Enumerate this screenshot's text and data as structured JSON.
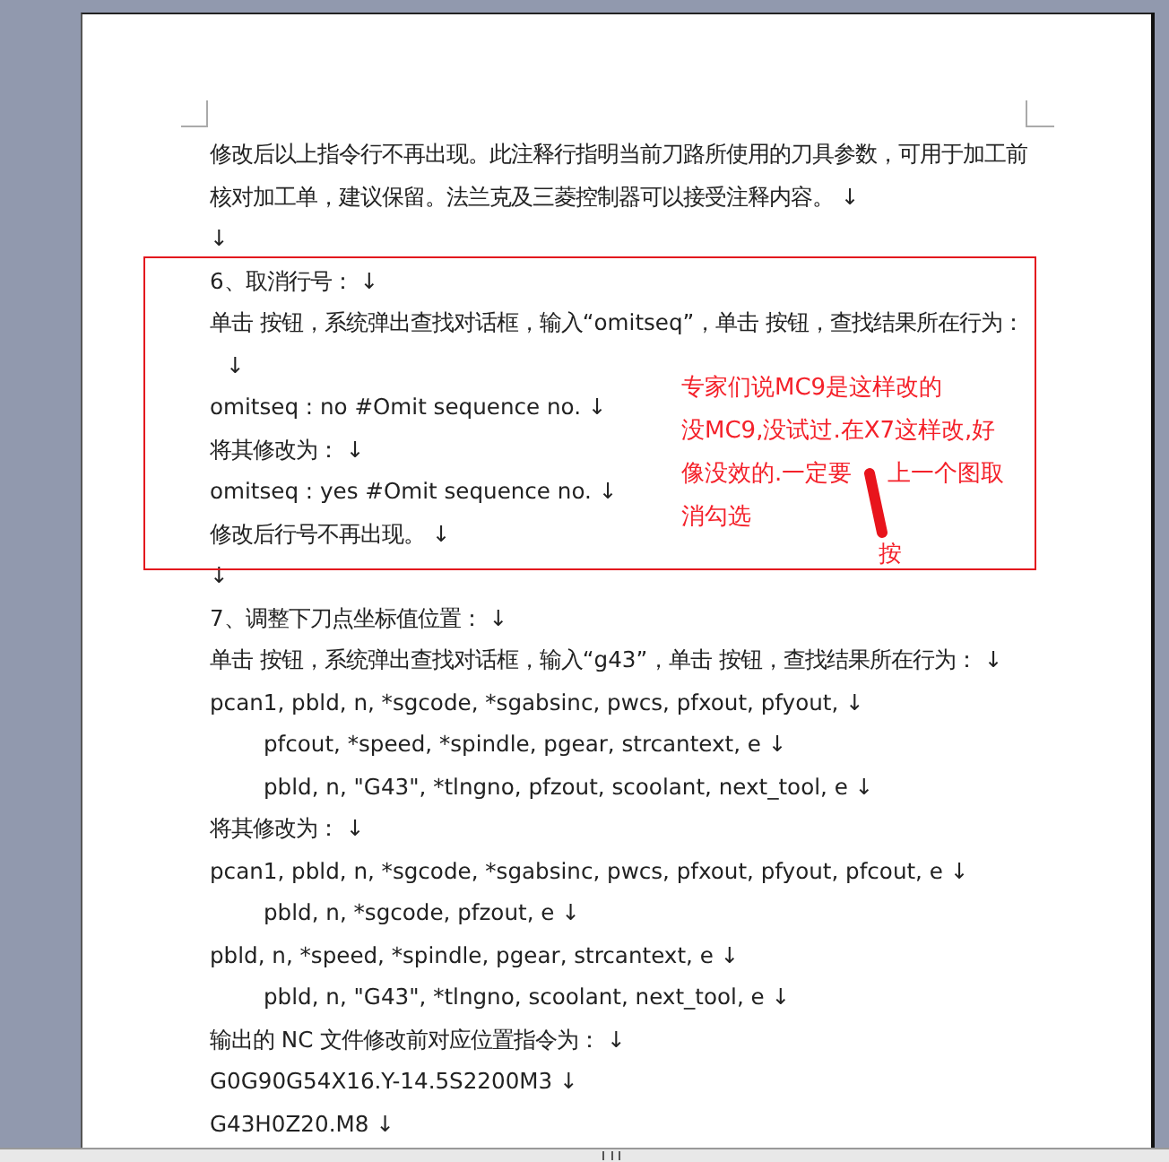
{
  "document": {
    "lines": [
      {
        "kind": "plain",
        "text": "修改后以上指令行不再出现。此注释行指明当前刀路所使用的刀具参数，可用于加工前"
      },
      {
        "kind": "plain",
        "text": "核对加工单，建议保留。法兰克及三菱控制器可以接受注释内容。 ↓"
      },
      {
        "kind": "plain",
        "text": "↓"
      },
      {
        "kind": "plain",
        "text": "6、取消行号：  ↓"
      },
      {
        "kind": "plain",
        "text": "单击  按钮，系统弹出查找对话框，输入“omitseq”，单击  按钮，查找结果所在行为："
      },
      {
        "kind": "continuation",
        "text": "↓"
      },
      {
        "kind": "plain",
        "text": "omitseq : no  #Omit sequence no. ↓"
      },
      {
        "kind": "plain",
        "text": "将其修改为：  ↓"
      },
      {
        "kind": "plain",
        "text": "omitseq : yes  #Omit sequence no. ↓"
      },
      {
        "kind": "plain",
        "text": "修改后行号不再出现。  ↓"
      },
      {
        "kind": "plain",
        "text": "↓"
      },
      {
        "kind": "plain",
        "text": "7、调整下刀点坐标值位置：  ↓"
      },
      {
        "kind": "plain",
        "text": "单击  按钮，系统弹出查找对话框，输入“g43”，单击  按钮，查找结果所在行为：  ↓"
      },
      {
        "kind": "plain",
        "text": "pcan1, pbld, n, *sgcode, *sgabsinc, pwcs, pfxout, pfyout, ↓"
      },
      {
        "kind": "indented",
        "text": "pfcout, *speed, *spindle, pgear, strcantext, e ↓"
      },
      {
        "kind": "indented",
        "text": "pbld, n, \"G43\", *tlngno, pfzout, scoolant, next_tool, e ↓"
      },
      {
        "kind": "plain",
        "text": "将其修改为：  ↓"
      },
      {
        "kind": "plain",
        "text": "pcan1, pbld, n, *sgcode, *sgabsinc, pwcs, pfxout, pfyout, pfcout, e ↓"
      },
      {
        "kind": "indented",
        "text": "pbld, n, *sgcode, pfzout, e ↓"
      },
      {
        "kind": "plain",
        "text": "pbld, n, *speed, *spindle, pgear, strcantext, e ↓"
      },
      {
        "kind": "indented",
        "text": "pbld, n, \"G43\", *tlngno, scoolant, next_tool, e ↓"
      },
      {
        "kind": "plain",
        "text": "输出的 NC 文件修改前对应位置指令为：  ↓"
      },
      {
        "kind": "plain",
        "text": "G0G90G54X16.Y-14.5S2200M3 ↓"
      },
      {
        "kind": "plain",
        "text": "G43H0Z20.M8 ↓"
      }
    ]
  },
  "annotation": {
    "lines": [
      [
        "专家们说MC9是这样改的"
      ],
      [
        "没MC9,没试过.在X7这样改,好"
      ],
      [
        "像没效的.一定要",
        "上一个图取"
      ],
      [
        "消勾选"
      ]
    ],
    "stray_char": "按"
  }
}
